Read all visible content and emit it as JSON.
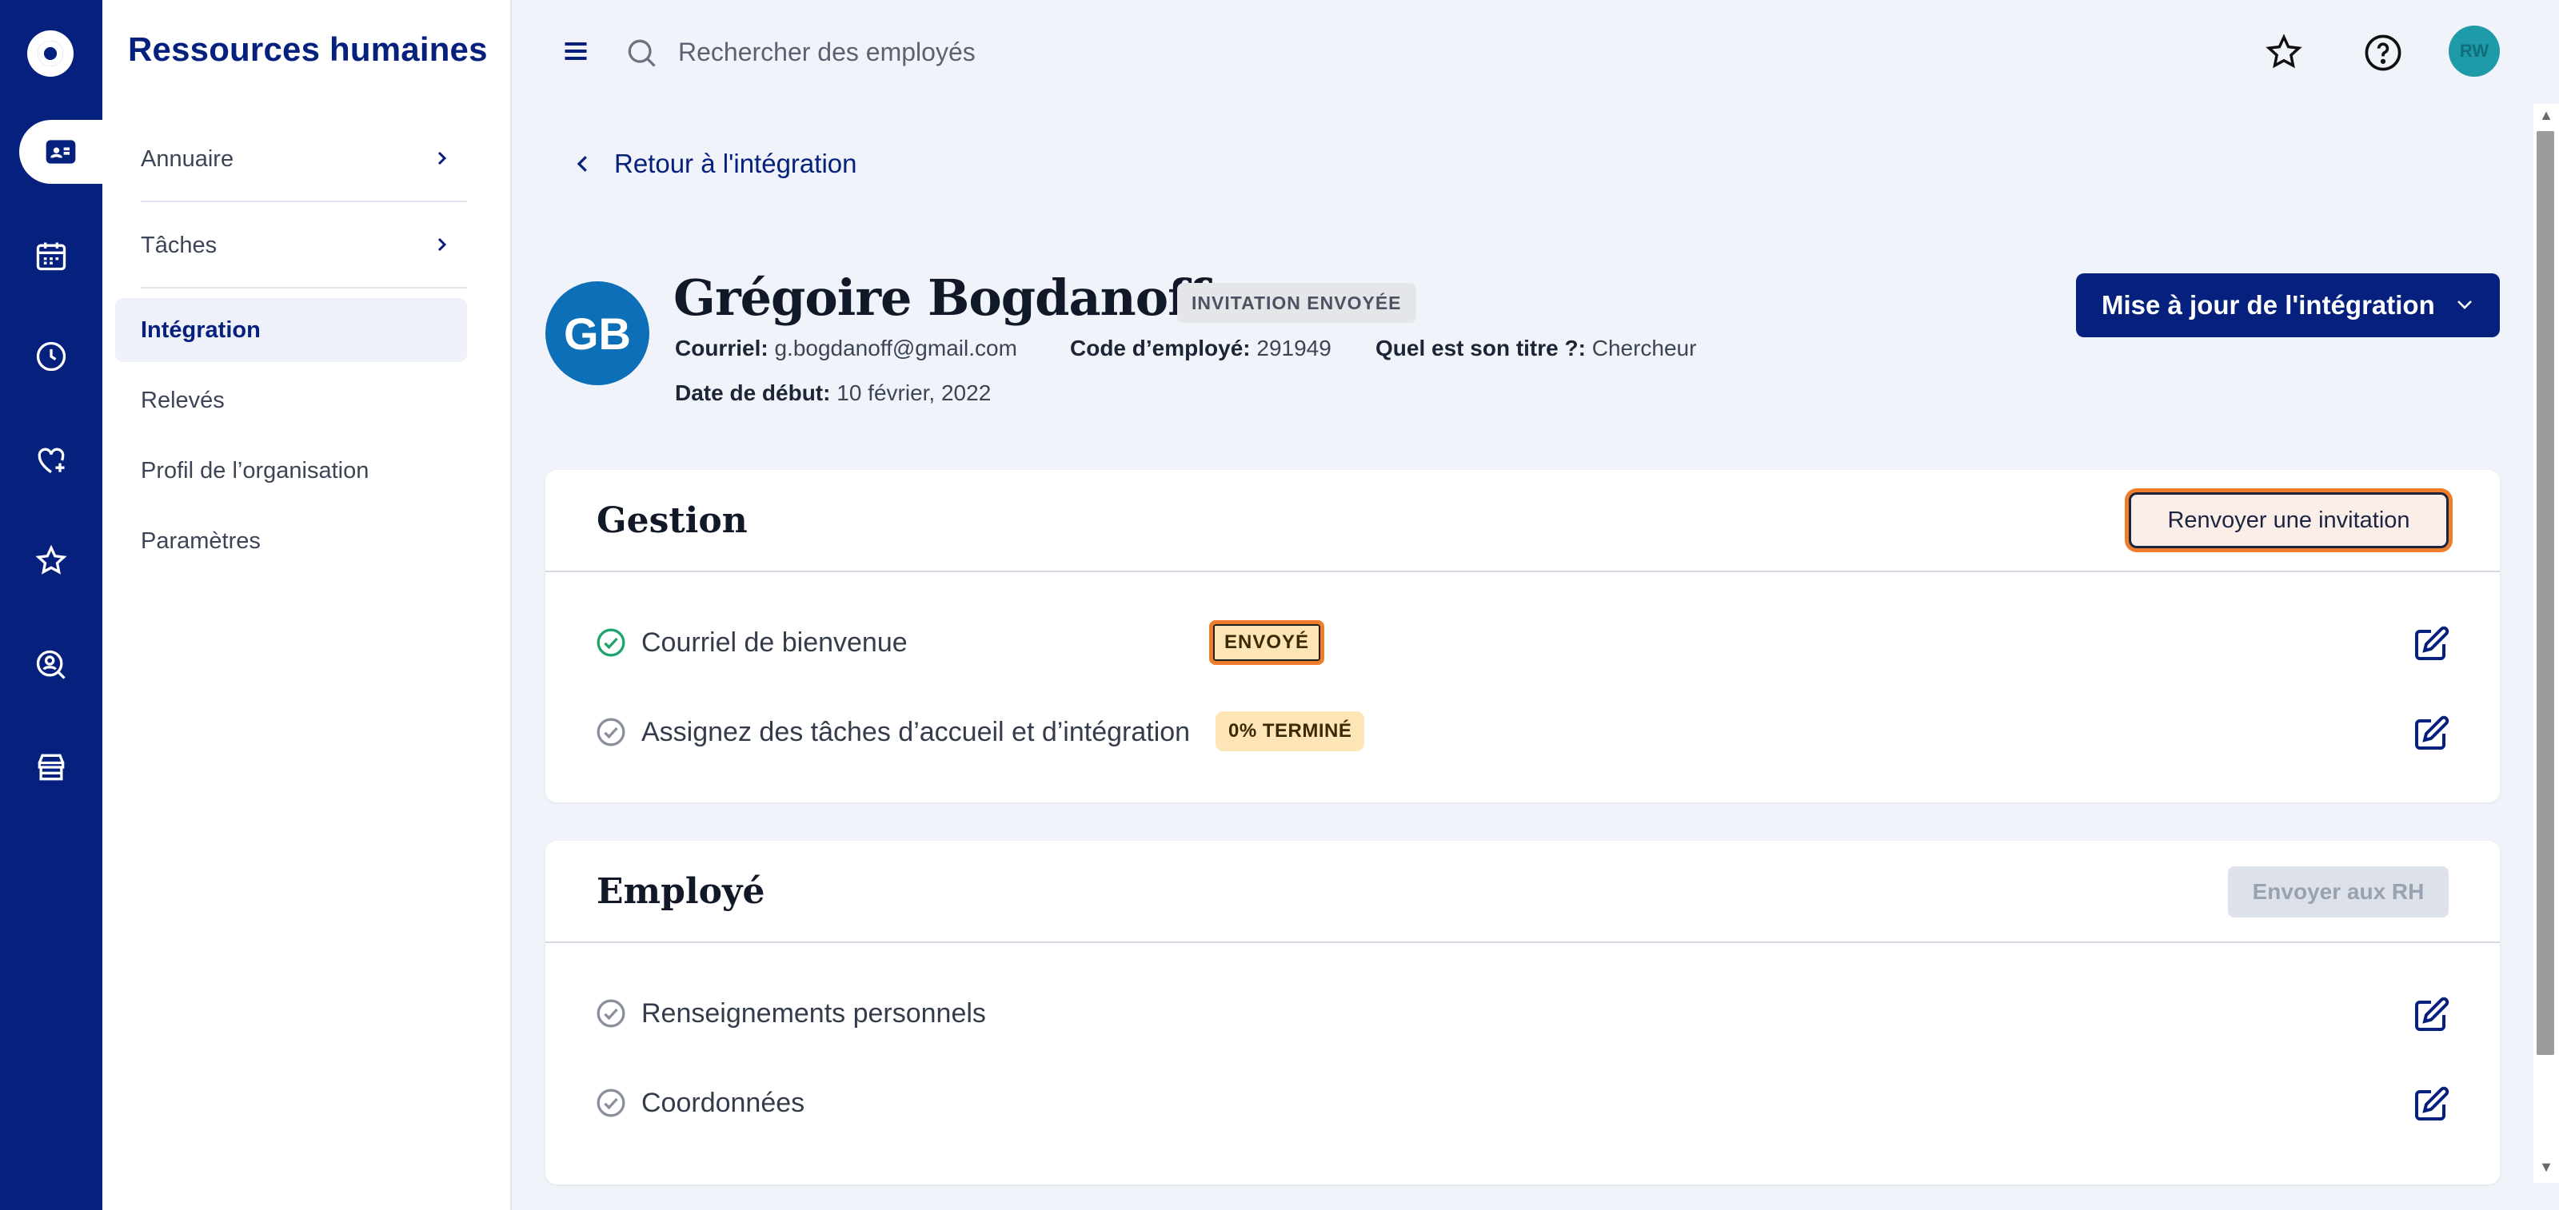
{
  "app": {
    "section_title": "Ressources humaines"
  },
  "sidebar": {
    "items": [
      {
        "label": "Annuaire",
        "has_chevron": true
      },
      {
        "label": "Tâches",
        "has_chevron": true
      },
      {
        "label": "Intégration",
        "active": true
      },
      {
        "label": "Relevés"
      },
      {
        "label": "Profil de l’organisation"
      },
      {
        "label": "Paramètres"
      }
    ]
  },
  "rail": {
    "icons": [
      "logo-icon",
      "people-card-icon",
      "calendar-icon",
      "clock-icon",
      "heart-plus-icon",
      "star-icon",
      "person-search-icon",
      "store-icon"
    ]
  },
  "topbar": {
    "search_placeholder": "Rechercher des employés",
    "avatar_initials": "RW"
  },
  "back_link": "Retour à l'intégration",
  "employee": {
    "initials": "GB",
    "name": "Grégoire Bogdanoff",
    "status_badge": "INVITATION ENVOYÉE",
    "email_label": "Courriel:",
    "email": "g.bogdanoff@gmail.com",
    "code_label": "Code d’employé:",
    "code": "291949",
    "title_label": "Quel est son titre ?:",
    "title": "Chercheur",
    "start_label": "Date de début:",
    "start": "10 février, 2022"
  },
  "actions": {
    "update_button": "Mise à jour de l'intégration"
  },
  "gestion": {
    "title": "Gestion",
    "resend_button": "Renvoyer une invitation",
    "rows": [
      {
        "label": "Courriel de bienvenue",
        "badge": "ENVOYÉ",
        "done": true
      },
      {
        "label": "Assignez des tâches d’accueil et d’intégration",
        "badge": "0% TERMINÉ",
        "done": false
      }
    ]
  },
  "employe": {
    "title": "Employé",
    "send_button": "Envoyer aux RH",
    "rows": [
      {
        "label": "Renseignements personnels"
      },
      {
        "label": "Coordonnées"
      }
    ]
  },
  "colors": {
    "brand": "#06217d",
    "highlight": "#f07d2c",
    "badge_yellow": "#fde5b6",
    "success": "#1fa46b"
  }
}
